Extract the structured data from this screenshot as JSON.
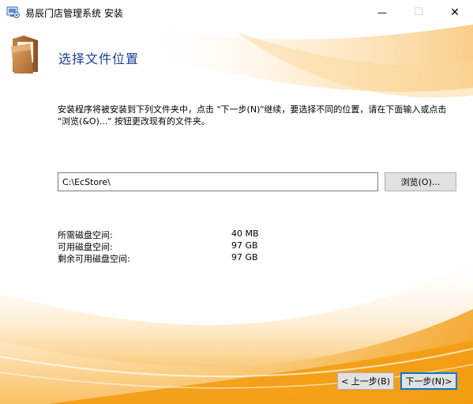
{
  "window": {
    "title": "易辰门店管理系统 安装",
    "minimize_glyph": "—",
    "maximize_glyph": "☐",
    "close_glyph": "✕"
  },
  "page": {
    "heading": "选择文件位置",
    "description": "安装程序将被安装到下列文件夹中，点击 \"下一步(N)\"继续，要选择不同的位置，请在下面输入或点击 \"浏览(&O)...\" 按钮更改现有的文件夹。"
  },
  "location": {
    "path_value": "C:\\EcStore\\",
    "browse_label": "浏览(O)..."
  },
  "disk_space": [
    {
      "label": "所需磁盘空间:",
      "value": "40 MB"
    },
    {
      "label": "可用磁盘空间:",
      "value": "97 GB"
    },
    {
      "label": "剩余可用磁盘空间:",
      "value": "97 GB"
    }
  ],
  "nav": {
    "back_label": "< 上一步(B)",
    "next_label": "下一步(N)>"
  },
  "colors": {
    "accent_orange": "#f5a623",
    "heading_blue": "#1f3f8f",
    "focus_blue": "#0078d7"
  },
  "icons": [
    "installer-app-icon",
    "folder-icon"
  ]
}
